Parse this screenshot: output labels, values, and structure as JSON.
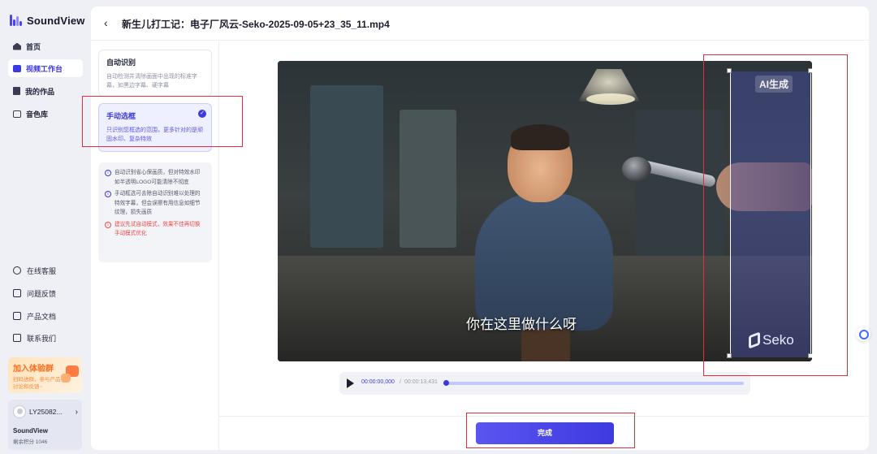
{
  "app": {
    "name": "SoundView"
  },
  "sidebar": {
    "items": [
      {
        "label": "首页",
        "icon": "home-icon"
      },
      {
        "label": "视频工作台",
        "icon": "video-workbench-icon",
        "active": true
      },
      {
        "label": "我的作品",
        "icon": "works-icon"
      },
      {
        "label": "音色库",
        "icon": "voice-library-icon"
      }
    ],
    "support": [
      {
        "label": "在线客服",
        "icon": "headset-icon"
      },
      {
        "label": "问题反馈",
        "icon": "mail-icon"
      },
      {
        "label": "产品文档",
        "icon": "document-icon"
      },
      {
        "label": "联系我们",
        "icon": "qrcode-icon"
      }
    ],
    "promo": {
      "title": "加入体验群",
      "subtitle": "扫码进群，参与产品讨论和反馈~"
    },
    "user": {
      "id": "LY25082...",
      "brand": "SoundView",
      "points": "剩余积分 1046"
    }
  },
  "header": {
    "back_icon": "chevron-left-icon",
    "title": "新生儿打工记：电子厂风云-Seko-2025-09-05+23_35_11.mp4"
  },
  "modes": {
    "auto": {
      "title": "自动识别",
      "desc": "自动检测并清除画面中出现的标准字幕，如黑边字幕、硬字幕"
    },
    "manual": {
      "title": "手动选框",
      "desc": "只识别您框选的范围，更多针对的是顽固水印、复杂特效",
      "selected": true
    }
  },
  "tips": [
    {
      "text": "自动识别省心保画质，但对特效水印如半透明LOGO可能清除不彻底",
      "type": "info"
    },
    {
      "text": "手动框选可去除自动识别难以处理的特效字幕，但会误擦有用信息如细节纹理，损失画质",
      "type": "info"
    },
    {
      "text": "建议先试自动模式，效果不佳再切换手动模式优化",
      "type": "warning"
    }
  ],
  "video": {
    "subtitle": "你在这里做什么呀",
    "ai_badge": "AI生成",
    "watermark": "Seko"
  },
  "player": {
    "current_time": "00:00:00,000",
    "separator": "/",
    "total_time": "00:00:13,431",
    "progress": 0
  },
  "actions": {
    "done_label": "完成"
  },
  "colors": {
    "accent": "#3d3ae0",
    "highlight": "#e0303a",
    "warning": "#f04848"
  }
}
